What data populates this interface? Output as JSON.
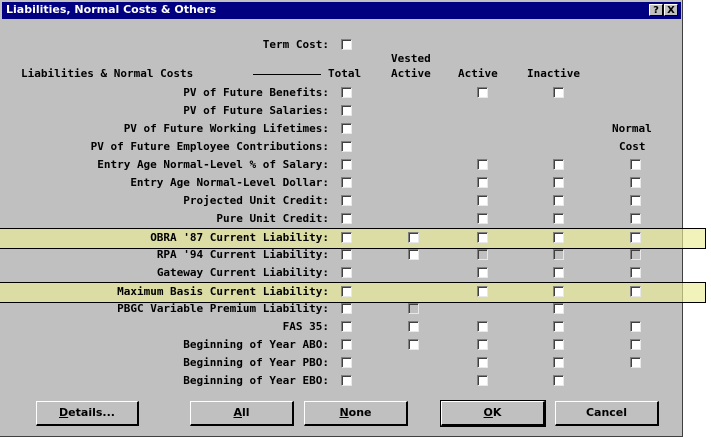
{
  "window": {
    "title": "Liabilities, Normal Costs & Others",
    "help_btn": "?",
    "close_btn": "X"
  },
  "term_cost_label": "Term Cost:",
  "section_label": "Liabilities & Normal Costs",
  "columns": {
    "total": "Total",
    "vested_active_1": "Vested",
    "vested_active_2": "Active",
    "active": "Active",
    "inactive": "Inactive",
    "normal_cost_1": "Normal",
    "normal_cost_2": "Cost"
  },
  "rows": [
    {
      "label": "PV of Future Benefits:"
    },
    {
      "label": "PV of Future Salaries:"
    },
    {
      "label": "PV of Future Working Lifetimes:"
    },
    {
      "label": "PV of Future Employee Contributions:"
    },
    {
      "label": "Entry Age Normal-Level % of Salary:"
    },
    {
      "label": "Entry Age Normal-Level Dollar:"
    },
    {
      "label": "Projected Unit Credit:"
    },
    {
      "label": "Pure Unit Credit:"
    },
    {
      "label": "OBRA '87 Current Liability:"
    },
    {
      "label": "RPA '94 Current Liability:"
    },
    {
      "label": "Gateway Current Liability:"
    },
    {
      "label": "Maximum Basis Current Liability:"
    },
    {
      "label": "PBGC Variable Premium Liability:"
    },
    {
      "label": "FAS 35:"
    },
    {
      "label": "Beginning of Year ABO:"
    },
    {
      "label": "Beginning of Year PBO:"
    },
    {
      "label": "Beginning of Year EBO:"
    }
  ],
  "buttons": {
    "details": {
      "mn": "D",
      "rest": "etails..."
    },
    "all": {
      "mn": "A",
      "rest": "ll"
    },
    "none": {
      "mn": "N",
      "rest": "one"
    },
    "ok": {
      "mn": "O",
      "rest": "K"
    },
    "cancel": "Cancel"
  },
  "highlight_color": "#ebeb96",
  "title_bar_color": "#000080"
}
